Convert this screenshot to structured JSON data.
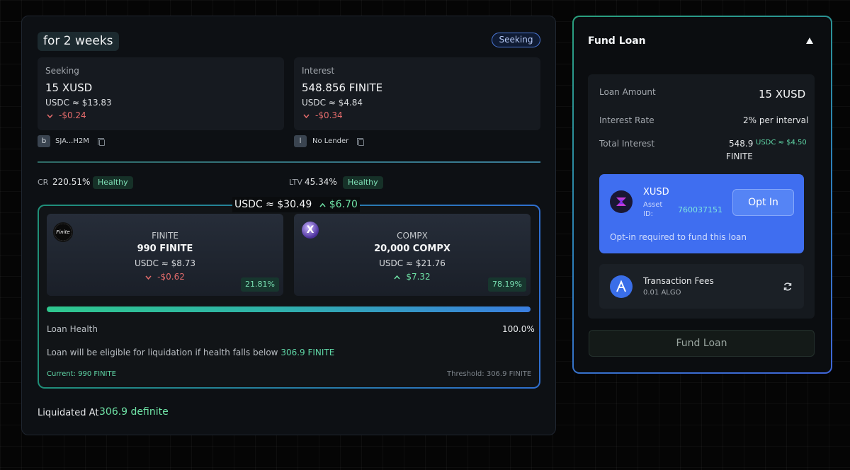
{
  "loan": {
    "duration": "for 2 weeks",
    "status": "Seeking"
  },
  "seeking": {
    "label": "Seeking",
    "amount": "15 XUSD",
    "usd": "USDC ≈ $13.83",
    "change": "-$0.24"
  },
  "interest": {
    "label": "Interest",
    "amount": "548.856 FINITE",
    "usd": "USDC ≈ $4.84",
    "change": "-$0.34"
  },
  "borrower": {
    "badge": "b",
    "address": "SJA...H2M"
  },
  "lender": {
    "badge": "l",
    "address": "No Lender"
  },
  "metrics": {
    "cr_label": "CR",
    "cr_value": "220.51%",
    "cr_status": "Healthy",
    "ltv_label": "LTV",
    "ltv_value": "45.34%",
    "ltv_status": "Healthy"
  },
  "collateral": {
    "total_usd": "USDC ≈ $30.49",
    "total_change": "$6.70",
    "assets": [
      {
        "logo_text": "Finite",
        "name": "FINITE",
        "amount": "990 FINITE",
        "usd": "USDC ≈ $8.73",
        "change": "-$0.62",
        "share": "21.81%"
      },
      {
        "logo_text": "X",
        "name": "COMPX",
        "amount": "20,000 COMPX",
        "usd": "USDC ≈ $21.76",
        "change": "$7.32",
        "share": "78.19%"
      }
    ],
    "health_label": "Loan Health",
    "health_value": "100.0%",
    "health_fraction": 1.0,
    "liquidation_note": "Loan will be eligible for liquidation if health falls below",
    "liquidation_threshold": "306.9 FINITE",
    "current_label": "Current: 990 FINITE",
    "threshold_label": "Threshold: 306.9 FINITE"
  },
  "liquidated": {
    "label": "Liquidated At",
    "value": "306.9 definite"
  },
  "fund": {
    "title": "Fund Loan",
    "loan_amount_label": "Loan Amount",
    "loan_amount_value": "15 XUSD",
    "interest_rate_label": "Interest Rate",
    "interest_rate_value": "2% per interval",
    "total_interest_label": "Total Interest",
    "total_interest_value": "548.9",
    "total_interest_unit": "FINITE",
    "total_interest_usd": "USDC ≈ $4.50",
    "asset": {
      "name": "XUSD",
      "id_label": "Asset ID:",
      "id_label_line1": "Asset",
      "id_label_line2": "ID:",
      "id_value": "760037151",
      "optin_label": "Opt In",
      "note": "Opt-in required to fund this loan"
    },
    "fees": {
      "label": "Transaction Fees",
      "value": "0.01 ALGO"
    },
    "button_label": "Fund Loan"
  },
  "colors": {
    "accent_green": "#6fe3a6",
    "accent_red": "#e36b6b",
    "accent_blue": "#3f6ef0"
  }
}
